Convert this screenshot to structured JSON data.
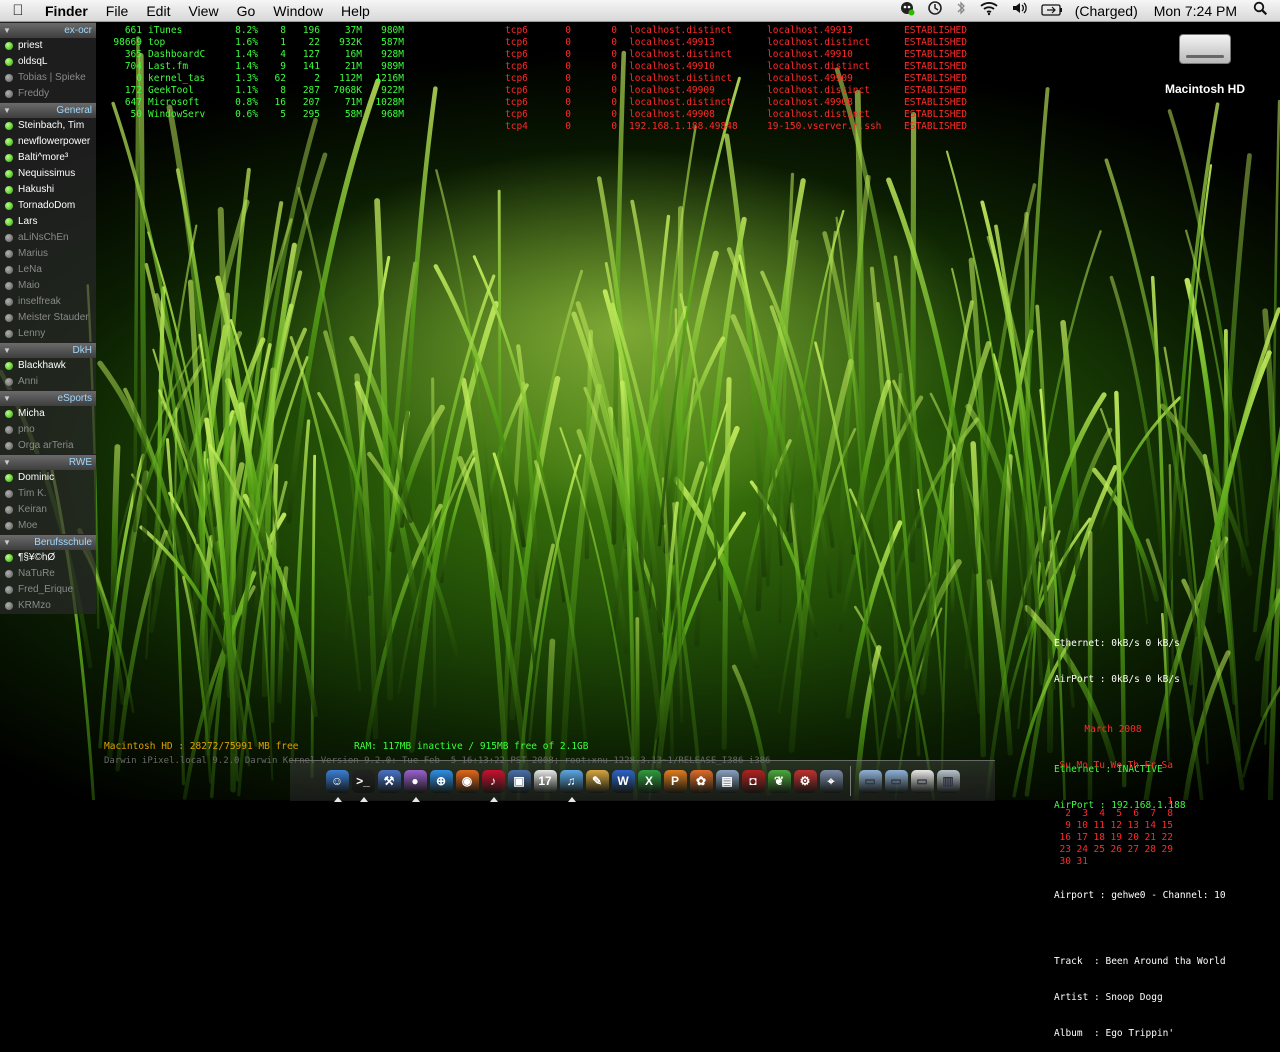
{
  "menubar": {
    "app": "Finder",
    "items": [
      "File",
      "Edit",
      "View",
      "Go",
      "Window",
      "Help"
    ],
    "status": {
      "battery": "(Charged)",
      "clock": "Mon 7:24 PM"
    },
    "icons": [
      "apple-icon",
      "adium-icon",
      "time-machine-icon",
      "bluetooth-icon",
      "wifi-icon",
      "volume-icon",
      "battery-icon",
      "spotlight-icon"
    ]
  },
  "buddylist": {
    "groups": [
      {
        "name": "ex-ocr",
        "buddies": [
          {
            "name": "priest",
            "online": true
          },
          {
            "name": "oldsqL",
            "online": true
          },
          {
            "name": "Tobias | Spieke",
            "online": false
          },
          {
            "name": "Freddy",
            "online": false
          }
        ]
      },
      {
        "name": "General",
        "buddies": [
          {
            "name": "Steinbach, Tim",
            "online": true
          },
          {
            "name": "newflowerpower",
            "online": true
          },
          {
            "name": "Balti^more³",
            "online": true
          },
          {
            "name": "Nequissimus",
            "online": true
          },
          {
            "name": "Hakushi",
            "online": true
          },
          {
            "name": "TornadoDom",
            "online": true
          },
          {
            "name": "Lars",
            "online": true
          },
          {
            "name": "aLiNsChEn",
            "online": false
          },
          {
            "name": "Marius",
            "online": false
          },
          {
            "name": "LeNa",
            "online": false
          },
          {
            "name": "Maio",
            "online": false
          },
          {
            "name": "inselfreak",
            "online": false
          },
          {
            "name": "Meister Stauder",
            "online": false
          },
          {
            "name": "Lenny",
            "online": false
          }
        ]
      },
      {
        "name": "DkH",
        "buddies": [
          {
            "name": "Blackhawk",
            "online": true
          },
          {
            "name": "Anni",
            "online": false
          }
        ]
      },
      {
        "name": "eSports",
        "buddies": [
          {
            "name": "Micha",
            "online": true
          },
          {
            "name": "pno",
            "online": false
          },
          {
            "name": "Orga arTeria",
            "online": false
          }
        ]
      },
      {
        "name": "RWE",
        "buddies": [
          {
            "name": "Dominic",
            "online": true
          },
          {
            "name": "Tim K.",
            "online": false
          },
          {
            "name": "Keiran",
            "online": false
          },
          {
            "name": "Moe",
            "online": false
          }
        ]
      },
      {
        "name": "Berufsschule",
        "buddies": [
          {
            "name": "¶§¥©hØ",
            "online": true
          },
          {
            "name": "NaTuRe",
            "online": false
          },
          {
            "name": "Fred_Erique",
            "online": false
          },
          {
            "name": "KRMzo",
            "online": false
          }
        ]
      }
    ]
  },
  "processes": [
    {
      "pid": "661",
      "cmd": "iTunes",
      "cpu": "8.2%",
      "th": "8",
      "prt": "196",
      "rprv": "37M",
      "vsize": "980M"
    },
    {
      "pid": "98669",
      "cmd": "top",
      "cpu": "1.6%",
      "th": "1",
      "prt": "22",
      "rprv": "932K",
      "vsize": "587M"
    },
    {
      "pid": "365",
      "cmd": "DashboardC",
      "cpu": "1.4%",
      "th": "4",
      "prt": "127",
      "rprv": "16M",
      "vsize": "928M"
    },
    {
      "pid": "704",
      "cmd": "Last.fm",
      "cpu": "1.4%",
      "th": "9",
      "prt": "141",
      "rprv": "21M",
      "vsize": "989M"
    },
    {
      "pid": "0",
      "cmd": "kernel_tas",
      "cpu": "1.3%",
      "th": "62",
      "prt": "2",
      "rprv": "112M",
      "vsize": "1216M"
    },
    {
      "pid": "172",
      "cmd": "GeekTool",
      "cpu": "1.1%",
      "th": "8",
      "prt": "287",
      "rprv": "7068K",
      "vsize": "922M"
    },
    {
      "pid": "647",
      "cmd": "Microsoft",
      "cpu": "0.8%",
      "th": "16",
      "prt": "207",
      "rprv": "71M",
      "vsize": "1028M"
    },
    {
      "pid": "50",
      "cmd": "WindowServ",
      "cpu": "0.6%",
      "th": "5",
      "prt": "295",
      "rprv": "58M",
      "vsize": "968M"
    }
  ],
  "netstat": [
    {
      "proto": "tcp6",
      "recv": "0",
      "send": "0",
      "local": "localhost.distinct",
      "foreign": "localhost.49913",
      "state": "ESTABLISHED"
    },
    {
      "proto": "tcp6",
      "recv": "0",
      "send": "0",
      "local": "localhost.49913",
      "foreign": "localhost.distinct",
      "state": "ESTABLISHED"
    },
    {
      "proto": "tcp6",
      "recv": "0",
      "send": "0",
      "local": "localhost.distinct",
      "foreign": "localhost.49910",
      "state": "ESTABLISHED"
    },
    {
      "proto": "tcp6",
      "recv": "0",
      "send": "0",
      "local": "localhost.49910",
      "foreign": "localhost.distinct",
      "state": "ESTABLISHED"
    },
    {
      "proto": "tcp6",
      "recv": "0",
      "send": "0",
      "local": "localhost.distinct",
      "foreign": "localhost.49909",
      "state": "ESTABLISHED"
    },
    {
      "proto": "tcp6",
      "recv": "0",
      "send": "0",
      "local": "localhost.49909",
      "foreign": "localhost.distinct",
      "state": "ESTABLISHED"
    },
    {
      "proto": "tcp6",
      "recv": "0",
      "send": "0",
      "local": "localhost.distinct",
      "foreign": "localhost.49908",
      "state": "ESTABLISHED"
    },
    {
      "proto": "tcp6",
      "recv": "0",
      "send": "0",
      "local": "localhost.49908",
      "foreign": "localhost.distinct",
      "state": "ESTABLISHED"
    },
    {
      "proto": "tcp4",
      "recv": "0",
      "send": "0",
      "local": "192.168.1.188.49848",
      "foreign": "19-150.vserver.r.ssh",
      "state": "ESTABLISHED"
    }
  ],
  "desktop": {
    "hd_label": "Macintosh HD"
  },
  "system": {
    "disk": "Macintosh HD : 28272/75991 MB free",
    "ram": "RAM: 117MB inactive / 915MB free of 2.1GB",
    "kernel": "Darwin iPixel.local 9.2.0 Darwin Kernel Version 9.2.0: Tue Feb  5 16:13:22 PST 2008; root:xnu-1228.3.13~1/RELEASE_I386 i386"
  },
  "netinfo": {
    "traffic": [
      "Ethernet: 0kB/s 0 kB/s",
      "AirPort : 0kB/s 0 kB/s"
    ],
    "status": [
      "Ethernet : INACTIVE",
      "AirPort : 192.168.1.188"
    ],
    "airport": "Airport : gehwe0 - Channel: 10",
    "track": "Track  : Been Around tha World",
    "artist": "Artist : Snoop Dogg",
    "album": "Album  : Ego Trippin'"
  },
  "calendar": {
    "title": "March 2008",
    "days": [
      "Su",
      "Mo",
      "Tu",
      "We",
      "Th",
      "Fr",
      "Sa"
    ],
    "weeks": [
      [
        "",
        "",
        "",
        "",
        "",
        "",
        "1"
      ],
      [
        "2",
        "3",
        "4",
        "5",
        "6",
        "7",
        "8"
      ],
      [
        "9",
        "10",
        "11",
        "12",
        "13",
        "14",
        "15"
      ],
      [
        "16",
        "17",
        "18",
        "19",
        "20",
        "21",
        "22"
      ],
      [
        "23",
        "24",
        "25",
        "26",
        "27",
        "28",
        "29"
      ],
      [
        "30",
        "31",
        "",
        "",
        "",
        "",
        ""
      ]
    ]
  },
  "dock": {
    "apps": [
      {
        "name": "finder",
        "color": "#3a7fd8",
        "glyph": "☺",
        "running": true
      },
      {
        "name": "terminal",
        "color": "#222222",
        "glyph": ">_",
        "running": true
      },
      {
        "name": "xcode",
        "color": "#4a72c8",
        "glyph": "⚒",
        "running": false
      },
      {
        "name": "adium",
        "color": "#9a5fd0",
        "glyph": "●",
        "running": true
      },
      {
        "name": "safari",
        "color": "#2e8fe6",
        "glyph": "⊕",
        "running": false
      },
      {
        "name": "firefox",
        "color": "#e2661c",
        "glyph": "◉",
        "running": false
      },
      {
        "name": "lastfm",
        "color": "#c8102e",
        "glyph": "♪",
        "running": true
      },
      {
        "name": "app-store-bag",
        "color": "#4a6ea8",
        "glyph": "▣",
        "running": false
      },
      {
        "name": "ical",
        "color": "#e8e8e8",
        "glyph": "17",
        "running": false
      },
      {
        "name": "itunes",
        "color": "#5aa7e6",
        "glyph": "♫",
        "running": true
      },
      {
        "name": "textedit",
        "color": "#d6a540",
        "glyph": "✎",
        "running": false
      },
      {
        "name": "word",
        "color": "#2c62c8",
        "glyph": "W",
        "running": false
      },
      {
        "name": "excel",
        "color": "#2e9a3e",
        "glyph": "X",
        "running": false
      },
      {
        "name": "powerpoint",
        "color": "#e07c20",
        "glyph": "P",
        "running": false
      },
      {
        "name": "flower",
        "color": "#e06a2a",
        "glyph": "✿",
        "running": false
      },
      {
        "name": "preview",
        "color": "#8aa0c0",
        "glyph": "▤",
        "running": false
      },
      {
        "name": "photo-booth",
        "color": "#b02020",
        "glyph": "◘",
        "running": false
      },
      {
        "name": "leaf-app",
        "color": "#4aa83a",
        "glyph": "❦",
        "running": false
      },
      {
        "name": "geektool",
        "color": "#c03030",
        "glyph": "⚙",
        "running": false
      },
      {
        "name": "network-utility",
        "color": "#7a8aa8",
        "glyph": "⌖",
        "running": false
      }
    ],
    "stacks": [
      {
        "name": "applications-folder",
        "color": "#8fb0d8",
        "glyph": "▭"
      },
      {
        "name": "documents-folder",
        "color": "#8fb0d8",
        "glyph": "▭"
      },
      {
        "name": "downloads-stack",
        "color": "#e8e8e8",
        "glyph": "▭"
      },
      {
        "name": "trash",
        "color": "#b8c4cc",
        "glyph": "▥"
      }
    ]
  }
}
